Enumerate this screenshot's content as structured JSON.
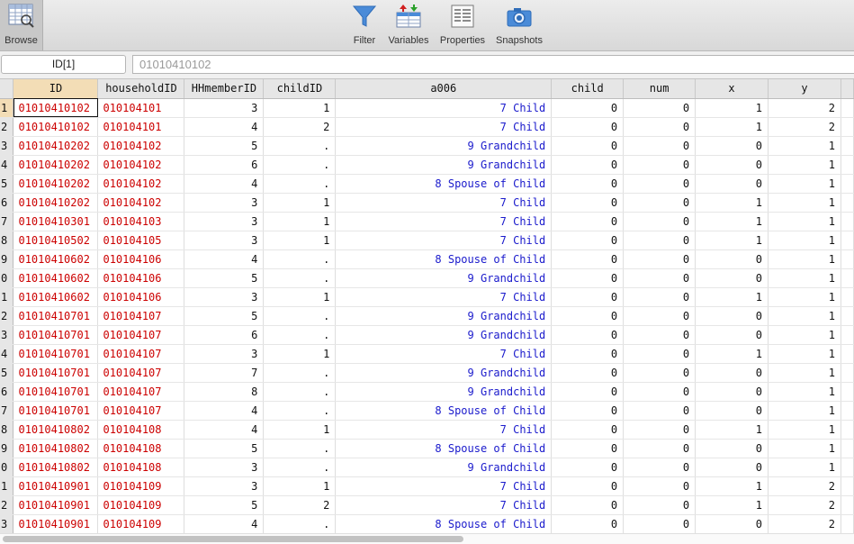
{
  "toolbar": {
    "browse": "Browse",
    "filter": "Filter",
    "variables": "Variables",
    "properties": "Properties",
    "snapshots": "Snapshots"
  },
  "cellref": {
    "ref": "ID[1]",
    "value": "01010410102"
  },
  "columns": [
    "ID",
    "householdID",
    "HHmemberID",
    "childID",
    "a006",
    "child",
    "num",
    "x",
    "y"
  ],
  "rows": [
    {
      "n": "1",
      "id": "01010410102",
      "hh": "010104101",
      "mem": "3",
      "cid": "1",
      "a006": "7 Child",
      "child": "0",
      "num": "0",
      "x": "1",
      "y": "2"
    },
    {
      "n": "2",
      "id": "01010410102",
      "hh": "010104101",
      "mem": "4",
      "cid": "2",
      "a006": "7 Child",
      "child": "0",
      "num": "0",
      "x": "1",
      "y": "2"
    },
    {
      "n": "3",
      "id": "01010410202",
      "hh": "010104102",
      "mem": "5",
      "cid": ".",
      "a006": "9 Grandchild",
      "child": "0",
      "num": "0",
      "x": "0",
      "y": "1"
    },
    {
      "n": "4",
      "id": "01010410202",
      "hh": "010104102",
      "mem": "6",
      "cid": ".",
      "a006": "9 Grandchild",
      "child": "0",
      "num": "0",
      "x": "0",
      "y": "1"
    },
    {
      "n": "5",
      "id": "01010410202",
      "hh": "010104102",
      "mem": "4",
      "cid": ".",
      "a006": "8 Spouse of Child",
      "child": "0",
      "num": "0",
      "x": "0",
      "y": "1"
    },
    {
      "n": "6",
      "id": "01010410202",
      "hh": "010104102",
      "mem": "3",
      "cid": "1",
      "a006": "7 Child",
      "child": "0",
      "num": "0",
      "x": "1",
      "y": "1"
    },
    {
      "n": "7",
      "id": "01010410301",
      "hh": "010104103",
      "mem": "3",
      "cid": "1",
      "a006": "7 Child",
      "child": "0",
      "num": "0",
      "x": "1",
      "y": "1"
    },
    {
      "n": "8",
      "id": "01010410502",
      "hh": "010104105",
      "mem": "3",
      "cid": "1",
      "a006": "7 Child",
      "child": "0",
      "num": "0",
      "x": "1",
      "y": "1"
    },
    {
      "n": "9",
      "id": "01010410602",
      "hh": "010104106",
      "mem": "4",
      "cid": ".",
      "a006": "8 Spouse of Child",
      "child": "0",
      "num": "0",
      "x": "0",
      "y": "1"
    },
    {
      "n": "0",
      "id": "01010410602",
      "hh": "010104106",
      "mem": "5",
      "cid": ".",
      "a006": "9 Grandchild",
      "child": "0",
      "num": "0",
      "x": "0",
      "y": "1"
    },
    {
      "n": "1",
      "id": "01010410602",
      "hh": "010104106",
      "mem": "3",
      "cid": "1",
      "a006": "7 Child",
      "child": "0",
      "num": "0",
      "x": "1",
      "y": "1"
    },
    {
      "n": "2",
      "id": "01010410701",
      "hh": "010104107",
      "mem": "5",
      "cid": ".",
      "a006": "9 Grandchild",
      "child": "0",
      "num": "0",
      "x": "0",
      "y": "1"
    },
    {
      "n": "3",
      "id": "01010410701",
      "hh": "010104107",
      "mem": "6",
      "cid": ".",
      "a006": "9 Grandchild",
      "child": "0",
      "num": "0",
      "x": "0",
      "y": "1"
    },
    {
      "n": "4",
      "id": "01010410701",
      "hh": "010104107",
      "mem": "3",
      "cid": "1",
      "a006": "7 Child",
      "child": "0",
      "num": "0",
      "x": "1",
      "y": "1"
    },
    {
      "n": "5",
      "id": "01010410701",
      "hh": "010104107",
      "mem": "7",
      "cid": ".",
      "a006": "9 Grandchild",
      "child": "0",
      "num": "0",
      "x": "0",
      "y": "1"
    },
    {
      "n": "6",
      "id": "01010410701",
      "hh": "010104107",
      "mem": "8",
      "cid": ".",
      "a006": "9 Grandchild",
      "child": "0",
      "num": "0",
      "x": "0",
      "y": "1"
    },
    {
      "n": "7",
      "id": "01010410701",
      "hh": "010104107",
      "mem": "4",
      "cid": ".",
      "a006": "8 Spouse of Child",
      "child": "0",
      "num": "0",
      "x": "0",
      "y": "1"
    },
    {
      "n": "8",
      "id": "01010410802",
      "hh": "010104108",
      "mem": "4",
      "cid": "1",
      "a006": "7 Child",
      "child": "0",
      "num": "0",
      "x": "1",
      "y": "1"
    },
    {
      "n": "9",
      "id": "01010410802",
      "hh": "010104108",
      "mem": "5",
      "cid": ".",
      "a006": "8 Spouse of Child",
      "child": "0",
      "num": "0",
      "x": "0",
      "y": "1"
    },
    {
      "n": "0",
      "id": "01010410802",
      "hh": "010104108",
      "mem": "3",
      "cid": ".",
      "a006": "9 Grandchild",
      "child": "0",
      "num": "0",
      "x": "0",
      "y": "1"
    },
    {
      "n": "1",
      "id": "01010410901",
      "hh": "010104109",
      "mem": "3",
      "cid": "1",
      "a006": "7 Child",
      "child": "0",
      "num": "0",
      "x": "1",
      "y": "2"
    },
    {
      "n": "2",
      "id": "01010410901",
      "hh": "010104109",
      "mem": "5",
      "cid": "2",
      "a006": "7 Child",
      "child": "0",
      "num": "0",
      "x": "1",
      "y": "2"
    },
    {
      "n": "3",
      "id": "01010410901",
      "hh": "010104109",
      "mem": "4",
      "cid": ".",
      "a006": "8 Spouse of Child",
      "child": "0",
      "num": "0",
      "x": "0",
      "y": "2"
    }
  ],
  "colors": {
    "string": "#cc0000",
    "label": "#1a1acc",
    "selected_header": "#f3ddb6"
  }
}
